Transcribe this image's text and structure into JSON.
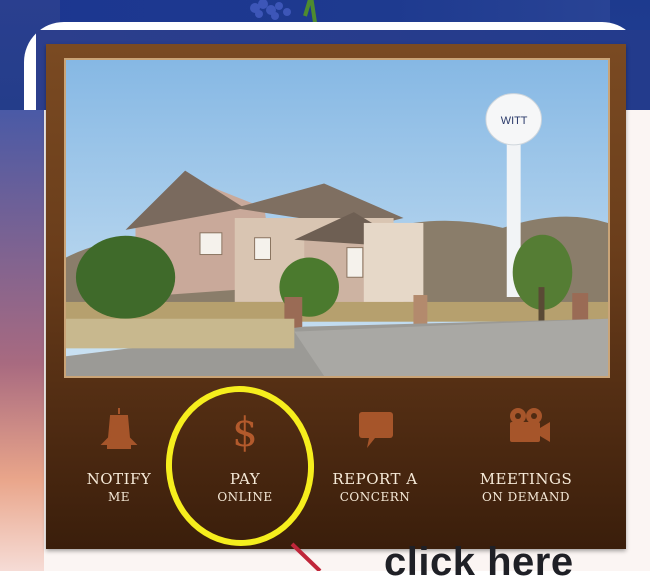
{
  "actions": [
    {
      "line1": "Notify",
      "line2": "Me",
      "icon": "bell-icon"
    },
    {
      "line1": "Pay",
      "line2": "Online",
      "icon": "dollar-icon"
    },
    {
      "line1": "Report a",
      "line2": "Concern",
      "icon": "speech-bubble-icon"
    },
    {
      "line1": "Meetings",
      "line2": "on Demand",
      "icon": "video-camera-icon"
    }
  ],
  "tower_text": "WITT",
  "annotation": {
    "text": "click here",
    "highlight_color": "#f6ee1d",
    "arrow_color": "#c0263a"
  },
  "colors": {
    "card": "#6b3e1b",
    "label": "#f6ead8",
    "icon": "#a6552a",
    "header": "#233b8c"
  }
}
